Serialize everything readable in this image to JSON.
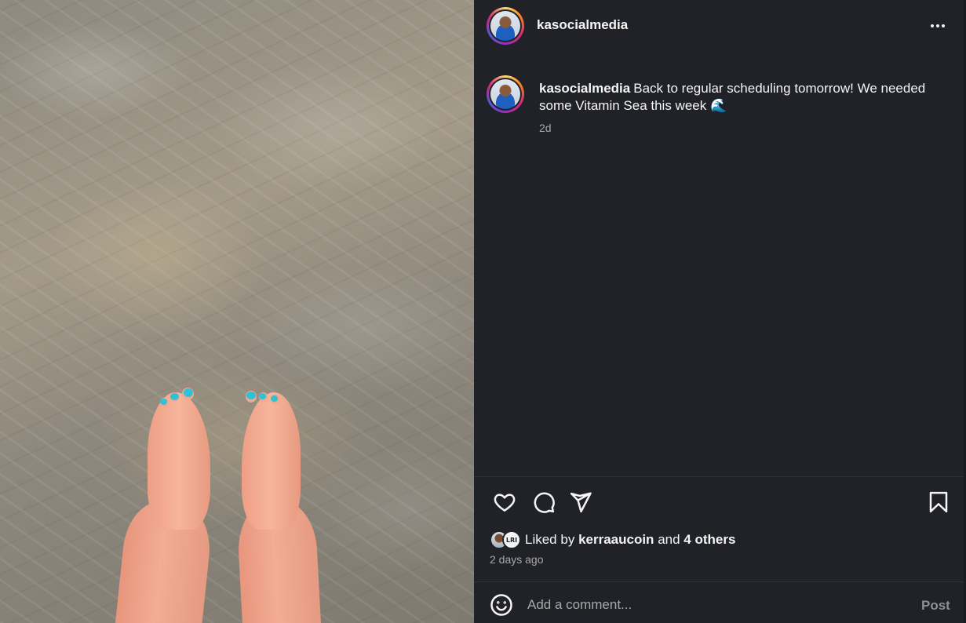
{
  "post": {
    "username": "kasocialmedia",
    "caption": {
      "username": "kasocialmedia",
      "text": "Back to regular scheduling tomorrow! We needed some Vitamin Sea this week 🌊",
      "time": "2d"
    },
    "likes": {
      "prefix": "Liked by",
      "user": "kerraaucoin",
      "joiner": "and",
      "others": "4 others",
      "second_avatar_text": "LRI"
    },
    "date": "2 days ago",
    "comment": {
      "placeholder": "Add a comment...",
      "post_label": "Post"
    }
  },
  "icons": {
    "more": "more-options-icon",
    "like": "heart-icon",
    "comment": "comment-bubble-icon",
    "share": "paper-plane-icon",
    "save": "bookmark-icon",
    "emoji": "emoji-smiley-icon"
  },
  "colors": {
    "panel_bg": "#212228",
    "text": "#f5f5f5",
    "muted": "#a8a8a8",
    "nail_polish": "#2fc2d6"
  }
}
